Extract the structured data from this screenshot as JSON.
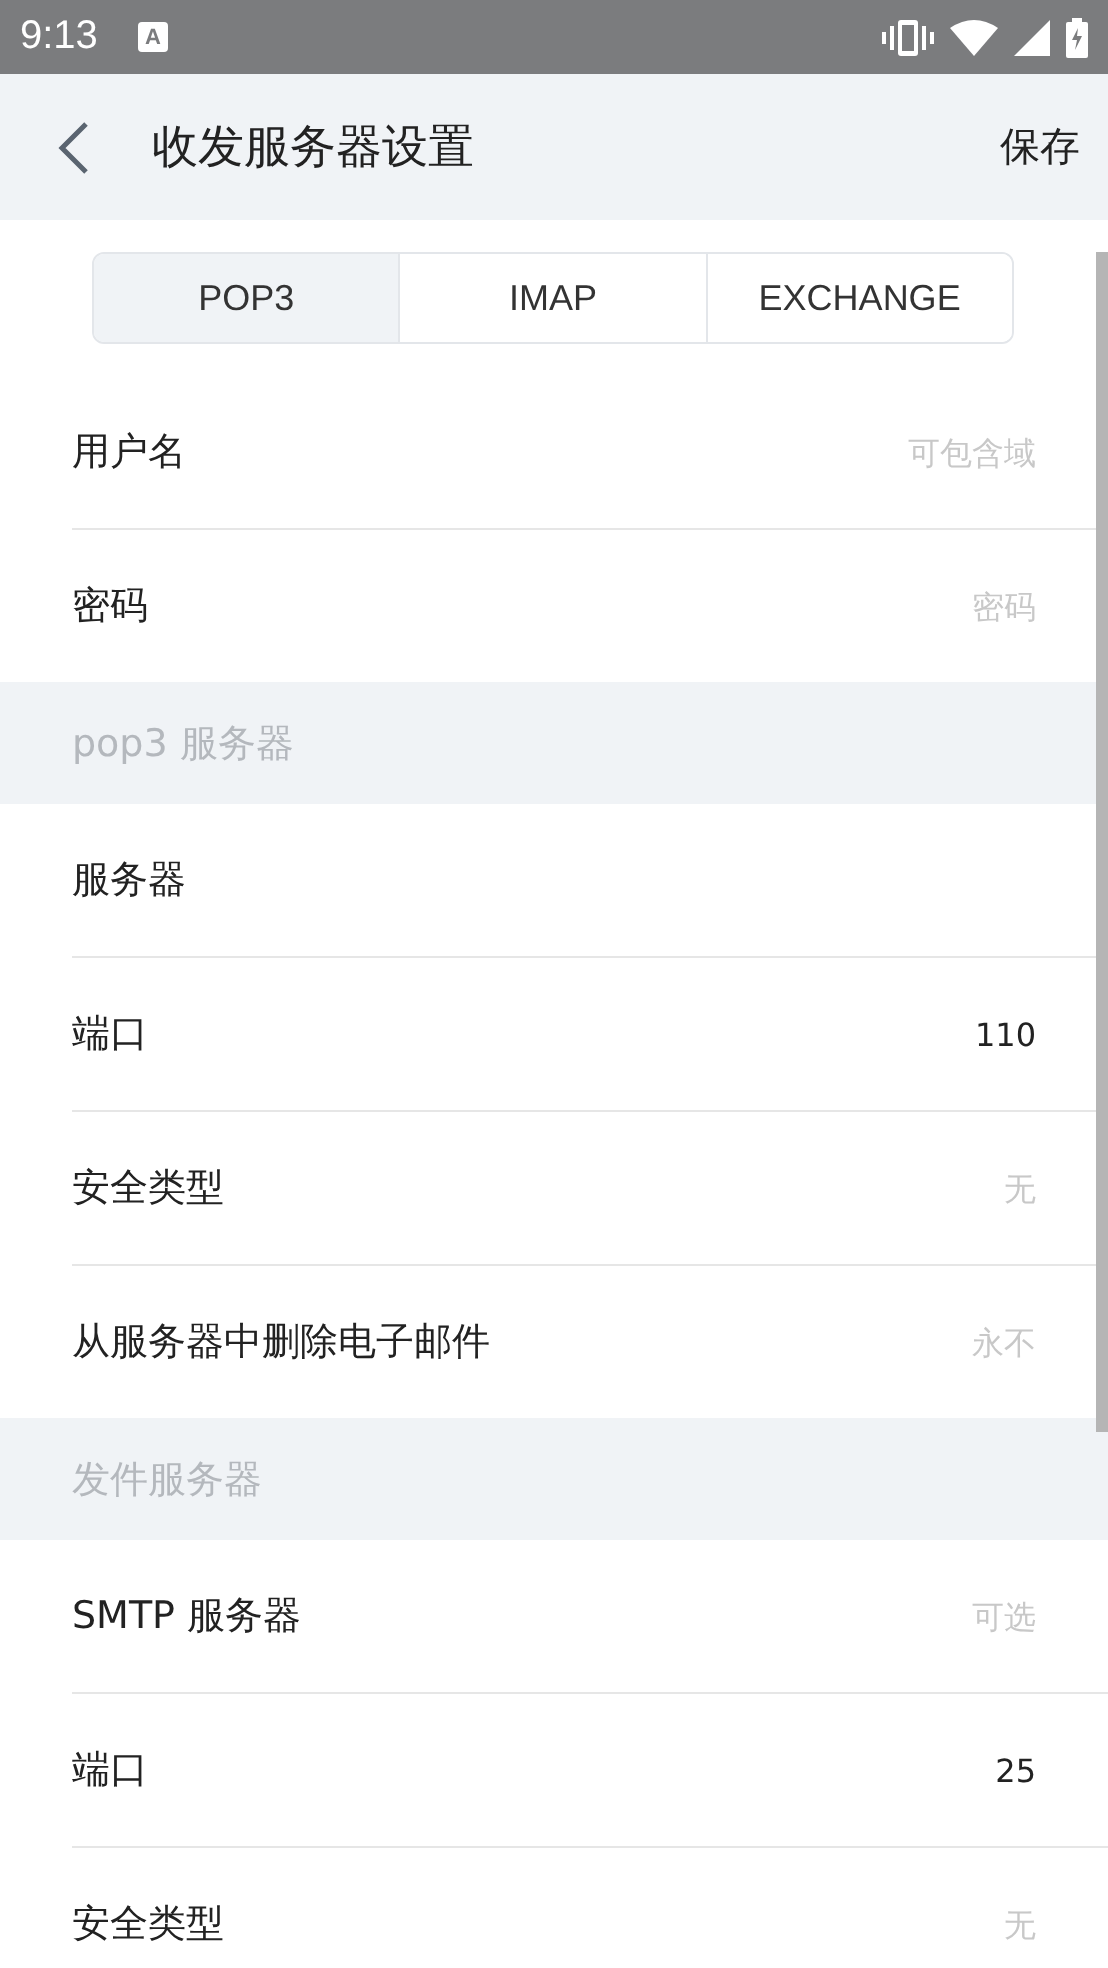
{
  "status_bar": {
    "time": "9:13",
    "notification_letter": "A"
  },
  "header": {
    "title": "收发服务器设置",
    "action": "保存"
  },
  "tabs": [
    {
      "label": "POP3",
      "selected": true
    },
    {
      "label": "IMAP",
      "selected": false
    },
    {
      "label": "EXCHANGE",
      "selected": false
    }
  ],
  "sections": [
    {
      "rows": [
        {
          "label": "用户名",
          "placeholder": "可包含域"
        },
        {
          "label": "密码",
          "placeholder": "密码"
        }
      ]
    },
    {
      "heading": "pop3 服务器",
      "rows": [
        {
          "label": "服务器"
        },
        {
          "label": "端口",
          "value": "110"
        },
        {
          "label": "安全类型",
          "placeholder": "无"
        },
        {
          "label": "从服务器中删除电子邮件",
          "placeholder": "永不"
        }
      ]
    },
    {
      "heading": "发件服务器",
      "rows": [
        {
          "label": "SMTP 服务器",
          "placeholder": "可选"
        },
        {
          "label": "端口",
          "value": "25"
        },
        {
          "label": "安全类型",
          "placeholder": "无"
        }
      ]
    }
  ]
}
